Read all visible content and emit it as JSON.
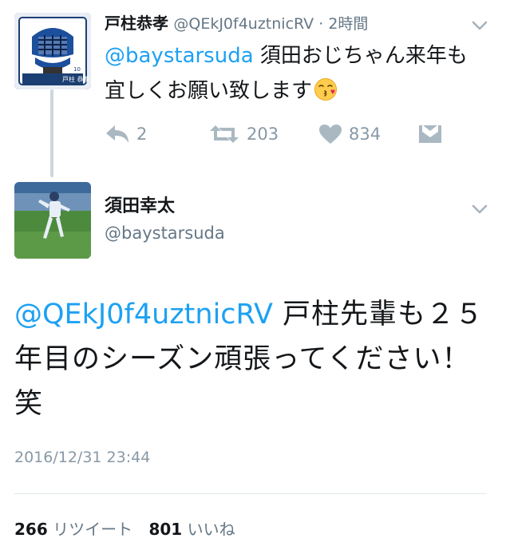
{
  "reply": {
    "name": "戸柱恭孝",
    "handle": "@QEkJ0f4uztnicRV",
    "separator": " · ",
    "time": "2時間",
    "mention": "@baystarsuda",
    "text": " 須田おじちゃん来年も宜しくお願い致します",
    "emoji": "kissing-face-emoji",
    "actions": {
      "reply_count": "2",
      "retweet_count": "203",
      "like_count": "834"
    }
  },
  "tweet": {
    "name": "須田幸太",
    "handle": "@baystarsuda",
    "mention": "@QEkJ0f4uztnicRV",
    "text": " 戸柱先輩も２５年目のシーズン頑張ってください！笑",
    "timestamp": "2016/12/31 23:44",
    "retweets": "266",
    "retweets_label": "リツイート",
    "likes": "801",
    "likes_label": "いいね"
  },
  "colors": {
    "link": "#1da1f2",
    "muted": "#8899a6",
    "text": "#14171a"
  }
}
